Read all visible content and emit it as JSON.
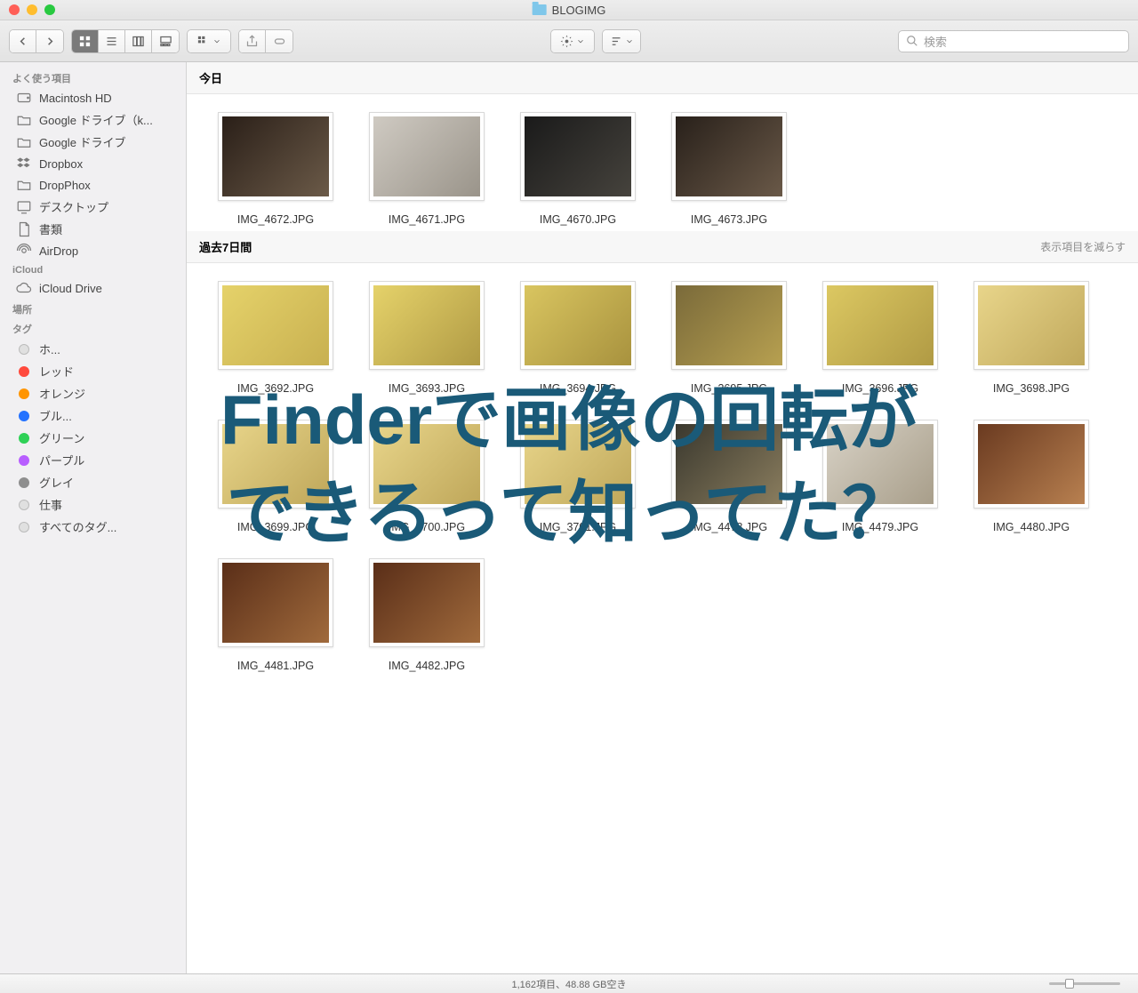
{
  "window": {
    "title": "BLOGIMG"
  },
  "search": {
    "placeholder": "検索"
  },
  "sidebar": {
    "sections": [
      {
        "header": "よく使う項目",
        "items": [
          {
            "label": "Macintosh HD",
            "icon": "hdd"
          },
          {
            "label": "Google ドライブ（k...",
            "icon": "folder"
          },
          {
            "label": "Google ドライブ",
            "icon": "folder"
          },
          {
            "label": "Dropbox",
            "icon": "dropbox"
          },
          {
            "label": "DropPhox",
            "icon": "folder"
          },
          {
            "label": "デスクトップ",
            "icon": "desktop"
          },
          {
            "label": "書類",
            "icon": "document"
          },
          {
            "label": "AirDrop",
            "icon": "airdrop"
          }
        ]
      },
      {
        "header": "iCloud",
        "items": [
          {
            "label": "iCloud Drive",
            "icon": "cloud"
          }
        ]
      },
      {
        "header": "場所",
        "items": []
      },
      {
        "header": "タグ",
        "items": [
          {
            "label": "ホ...",
            "icon": "tag",
            "color": "#e0e0e0"
          },
          {
            "label": "レッド",
            "icon": "tag",
            "color": "#ff4a3d"
          },
          {
            "label": "オレンジ",
            "icon": "tag",
            "color": "#ff9500"
          },
          {
            "label": "ブル...",
            "icon": "tag",
            "color": "#2472ff"
          },
          {
            "label": "グリーン",
            "icon": "tag",
            "color": "#2fd157"
          },
          {
            "label": "パープル",
            "icon": "tag",
            "color": "#b85eff"
          },
          {
            "label": "グレイ",
            "icon": "tag",
            "color": "#8e8e8e"
          },
          {
            "label": "仕事",
            "icon": "tag",
            "color": "#e0e0e0"
          },
          {
            "label": "すべてのタグ...",
            "icon": "tag",
            "color": "#e0e0e0"
          }
        ]
      }
    ]
  },
  "content": {
    "sections": [
      {
        "title": "今日",
        "reduce": null,
        "items": [
          {
            "label": "IMG_4672.JPG",
            "c1": "#2a1f18",
            "c2": "#6b5a48"
          },
          {
            "label": "IMG_4671.JPG",
            "c1": "#cfcac2",
            "c2": "#9a948a"
          },
          {
            "label": "IMG_4670.JPG",
            "c1": "#1a1a1a",
            "c2": "#46433d"
          },
          {
            "label": "IMG_4673.JPG",
            "c1": "#28201a",
            "c2": "#6a5948"
          }
        ]
      },
      {
        "title": "過去7日間",
        "reduce": "表示項目を減らす",
        "items": [
          {
            "label": "IMG_3692.JPG",
            "c1": "#e5d26a",
            "c2": "#c8b050"
          },
          {
            "label": "IMG_3693.JPG",
            "c1": "#e5d26a",
            "c2": "#b09a44"
          },
          {
            "label": "IMG_3694.JPG",
            "c1": "#d9c560",
            "c2": "#a8923e"
          },
          {
            "label": "IMG_3695.JPG",
            "c1": "#7a6a3a",
            "c2": "#b7a050"
          },
          {
            "label": "IMG_3696.JPG",
            "c1": "#dcc862",
            "c2": "#b09a44"
          },
          {
            "label": "IMG_3698.JPG",
            "c1": "#e8d58a",
            "c2": "#c0a85c"
          },
          {
            "label": "IMG_3699.JPG",
            "c1": "#e8d58a",
            "c2": "#bfa75a"
          },
          {
            "label": "IMG_3700.JPG",
            "c1": "#e8d58a",
            "c2": "#bfa75a"
          },
          {
            "label": "IMG_3701.JPG",
            "c1": "#e8d58a",
            "c2": "#bfa75a"
          },
          {
            "label": "IMG_4478.JPG",
            "c1": "#3a382e",
            "c2": "#8a7d5e"
          },
          {
            "label": "IMG_4479.JPG",
            "c1": "#d8d2c6",
            "c2": "#a89e8a"
          },
          {
            "label": "IMG_4480.JPG",
            "c1": "#6a3a20",
            "c2": "#b88050"
          },
          {
            "label": "IMG_4481.JPG",
            "c1": "#5a2e18",
            "c2": "#a06a3c"
          },
          {
            "label": "IMG_4482.JPG",
            "c1": "#5a2e18",
            "c2": "#a06a3c"
          }
        ]
      }
    ]
  },
  "statusbar": {
    "text": "1,162項目、48.88 GB空き"
  },
  "overlay": {
    "line1": "Finderで画像の回転が",
    "line2": "できるって知ってた？"
  }
}
